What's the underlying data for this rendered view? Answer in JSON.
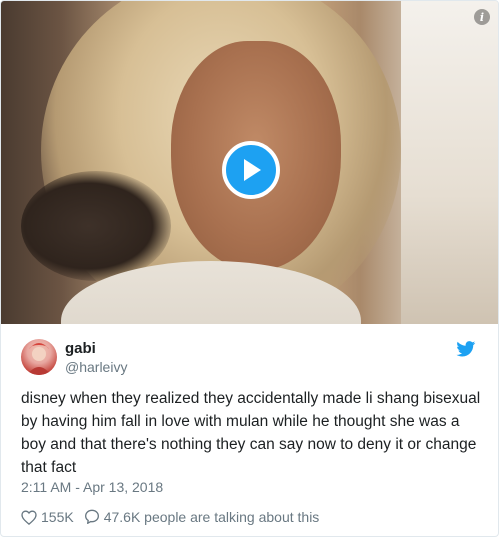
{
  "media": {
    "type": "video",
    "icons": {
      "info": "info-icon",
      "play": "play-icon"
    }
  },
  "author": {
    "display_name": "gabi",
    "handle": "@harleivy"
  },
  "tweet": {
    "text": "disney when they realized they accidentally made li shang bisexual by having him fall in love with mulan while he thought she was a boy and that there's nothing they can say now to deny it or change that fact",
    "timestamp": "2:11 AM - Apr 13, 2018"
  },
  "actions": {
    "likes": "155K",
    "talking": "47.6K people are talking about this"
  },
  "colors": {
    "accent": "#1da1f2",
    "text": "#1c2022",
    "muted": "#697882",
    "border": "#e1e8ed"
  }
}
